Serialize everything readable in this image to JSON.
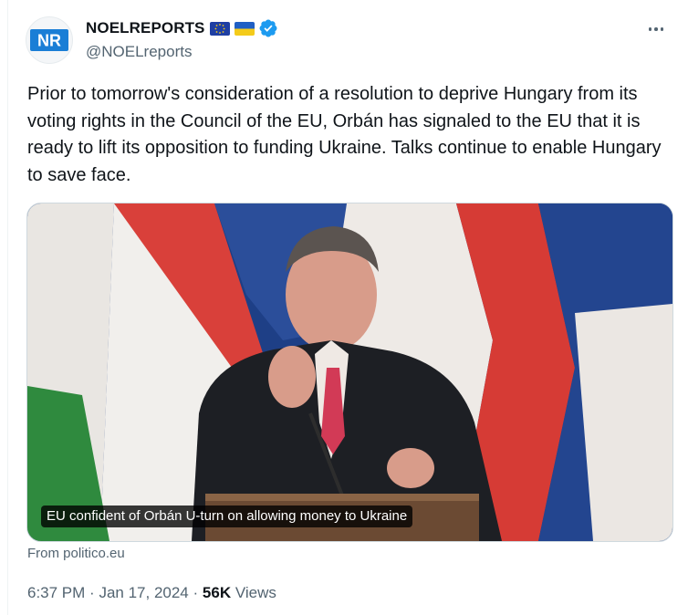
{
  "author": {
    "logo_text": "NR",
    "display_name": "NOELREPORTS",
    "handle": "@NOELreports",
    "badges": [
      "eu-flag-icon",
      "ukraine-flag-icon",
      "verified-badge-icon"
    ]
  },
  "tweet": {
    "text": "Prior to tomorrow's consideration of a resolution to deprive Hungary from its voting rights in the Council of the EU, Orbán has signaled to the EU that it is ready to lift its opposition to funding Ukraine. Talks continue to enable Hungary to save face."
  },
  "card": {
    "headline": "EU confident of Orbán U-turn on allowing money to Ukraine",
    "source": "From politico.eu"
  },
  "meta": {
    "time": "6:37 PM",
    "separator": "·",
    "date": "Jan 17, 2024",
    "views_count": "56K",
    "views_label": "Views"
  },
  "colors": {
    "text": "#0f1419",
    "secondary": "#536471",
    "verified": "#1d9bf0",
    "logo_blue": "#1a7ed6"
  }
}
